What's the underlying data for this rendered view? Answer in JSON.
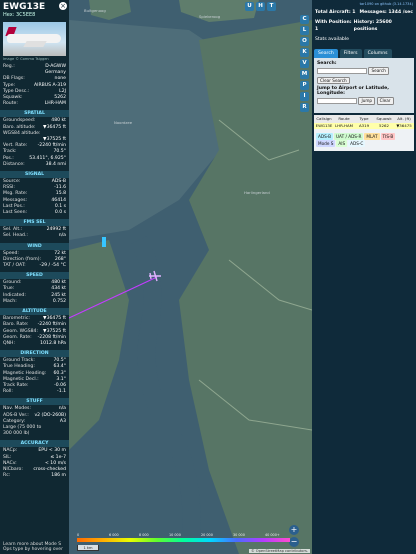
{
  "left": {
    "title": "EWG13E",
    "hex": "Hex: 3C5EE8",
    "photo_credit": "Image © Comma Tsiggen",
    "basic": [
      {
        "k": "Reg.:",
        "v": "D-AGWW"
      },
      {
        "k": "",
        "v": "Germany"
      },
      {
        "k": "DB Flags:",
        "v": "none"
      },
      {
        "k": "Type:",
        "v": "AIRBUS A-319"
      },
      {
        "k": "",
        "v": ""
      },
      {
        "k": "Type Desc.:",
        "v": "L2J"
      },
      {
        "k": "Squawk:",
        "v": "5262"
      },
      {
        "k": "Route:",
        "v": "LHR-HAM"
      }
    ],
    "spatial_title": "SPATIAL",
    "spatial": [
      {
        "k": "Groundspeed:",
        "v": "480 kt"
      },
      {
        "k": "Baro. altitude:",
        "v": "▼36475 ft"
      },
      {
        "k": "WGS84 altitude:",
        "v": ""
      },
      {
        "k": "",
        "v": "▼37525 ft"
      },
      {
        "k": "Vert. Rate:",
        "v": "-2240 ft/min"
      },
      {
        "k": "Track:",
        "v": "70.5°"
      },
      {
        "k": "Pos.:",
        "v": "53.411°, 6.925°"
      },
      {
        "k": "Distance:",
        "v": "38.4 nmi"
      }
    ],
    "signal_title": "SIGNAL",
    "signal": [
      {
        "k": "Source:",
        "v": "ADS-B"
      },
      {
        "k": "RSSI:",
        "v": "-11.6"
      },
      {
        "k": "Msg. Rate:",
        "v": "15.8"
      },
      {
        "k": "Messages:",
        "v": "46414"
      },
      {
        "k": "Last Pos.:",
        "v": "0.1 s"
      },
      {
        "k": "Last Seen:",
        "v": "0.0 s"
      }
    ],
    "fms_title": "FMS SEL",
    "fms": [
      {
        "k": "Sel. Alt.:",
        "v": "24992 ft"
      },
      {
        "k": "Sel. Head.:",
        "v": "n/a"
      }
    ],
    "wind_title": "WIND",
    "wind": [
      {
        "k": "Speed:",
        "v": "72 kt"
      },
      {
        "k": "Direction (from):",
        "v": "268°"
      },
      {
        "k": "TAT / OAT:",
        "v": "-29 / -54 °C"
      }
    ],
    "speed_title": "SPEED",
    "speed": [
      {
        "k": "Ground:",
        "v": "480 kt"
      },
      {
        "k": "True:",
        "v": "434 kt"
      },
      {
        "k": "Indicated:",
        "v": "245 kt"
      },
      {
        "k": "Mach:",
        "v": "0.752"
      }
    ],
    "altitude_title": "ALTITUDE",
    "altitude": [
      {
        "k": "Barometric:",
        "v": "▼36475 ft"
      },
      {
        "k": "Baro. Rate:",
        "v": "-2240 ft/min"
      },
      {
        "k": "Geom. WGS84:",
        "v": "▼37525 ft"
      },
      {
        "k": "Geom. Rate:",
        "v": "-2208 ft/min"
      },
      {
        "k": "QNH:",
        "v": "1012.8 hPa"
      }
    ],
    "direction_title": "DIRECTION",
    "direction": [
      {
        "k": "Ground Track:",
        "v": "70.5°"
      },
      {
        "k": "True Heading:",
        "v": "63.4°"
      },
      {
        "k": "Magnetic Heading:",
        "v": "60.3°"
      },
      {
        "k": "Magnetic Decl.:",
        "v": "3.1°"
      },
      {
        "k": "Track Rate:",
        "v": "-0.06"
      },
      {
        "k": "Roll:",
        "v": "-1.1"
      }
    ],
    "stuff_title": "STUFF",
    "stuff": [
      {
        "k": "Nav. Modes:",
        "v": "n/a"
      },
      {
        "k": "ADS-B Ver.:",
        "v": "v2 (DO-260B)"
      },
      {
        "k": "Category:",
        "v": "A3"
      },
      {
        "k": "Large (75 000 to",
        "v": ""
      },
      {
        "k": "300 000 lb)",
        "v": ""
      }
    ],
    "accuracy_title": "ACCURACY",
    "accuracy": [
      {
        "k": "NACp:",
        "v": "EPU < 30 m"
      },
      {
        "k": "SIL:",
        "v": "≤ 1e-7"
      },
      {
        "k": "NACv:",
        "v": "< 10 m/s"
      },
      {
        "k": "NICbaro:",
        "v": "cross-checked"
      },
      {
        "k": "Rc:",
        "v": "186 m"
      }
    ],
    "footer": "Learn more about Mode S Ops type by hovering over"
  },
  "map": {
    "labels": [
      "Bultgenoog",
      "Spiekeroog",
      "Noordzee",
      "Harlingerland"
    ],
    "buttons": [
      "U",
      "H",
      "T"
    ],
    "scale": "1 km",
    "altitude_labels": [
      "0",
      "6 000",
      "8 000",
      "10 000",
      "20 000",
      "30 000",
      "40 000+"
    ],
    "attribution": "© OpenStreetMap contributors."
  },
  "right": {
    "top_link": "tar1090 on github (3.14.1734)",
    "stats": [
      {
        "k": "Total Aircraft: 1",
        "v": "Messages: 1344 /sec"
      },
      {
        "k": "With Position: 1",
        "v": "History: 25600 positions"
      }
    ],
    "stats_available": "Stats available",
    "tabs": [
      "Search",
      "Filters",
      "Columns"
    ],
    "search_label": "Search:",
    "search_button": "Search",
    "clear_search": "Clear Search",
    "jump_label": "Jump to Airport or Latitude, Longitude:",
    "jump_button": "Jump",
    "clear_button": "Clear",
    "table_headers": [
      "Callsign",
      "Route",
      "Type",
      "Squawk",
      "Alt. (ft)"
    ],
    "table_row": [
      "EWG13E",
      "LHR-HAM",
      "A319",
      "5262",
      "▼36475"
    ],
    "sources": [
      "ADS-B",
      "UAT / ADS-R",
      "MLAT",
      "TIS-B",
      "Mode S",
      "AIS",
      "ADS-C"
    ],
    "side_buttons": [
      "C",
      "L",
      "O",
      "K",
      "V",
      "M",
      "P",
      "I",
      "R"
    ]
  }
}
